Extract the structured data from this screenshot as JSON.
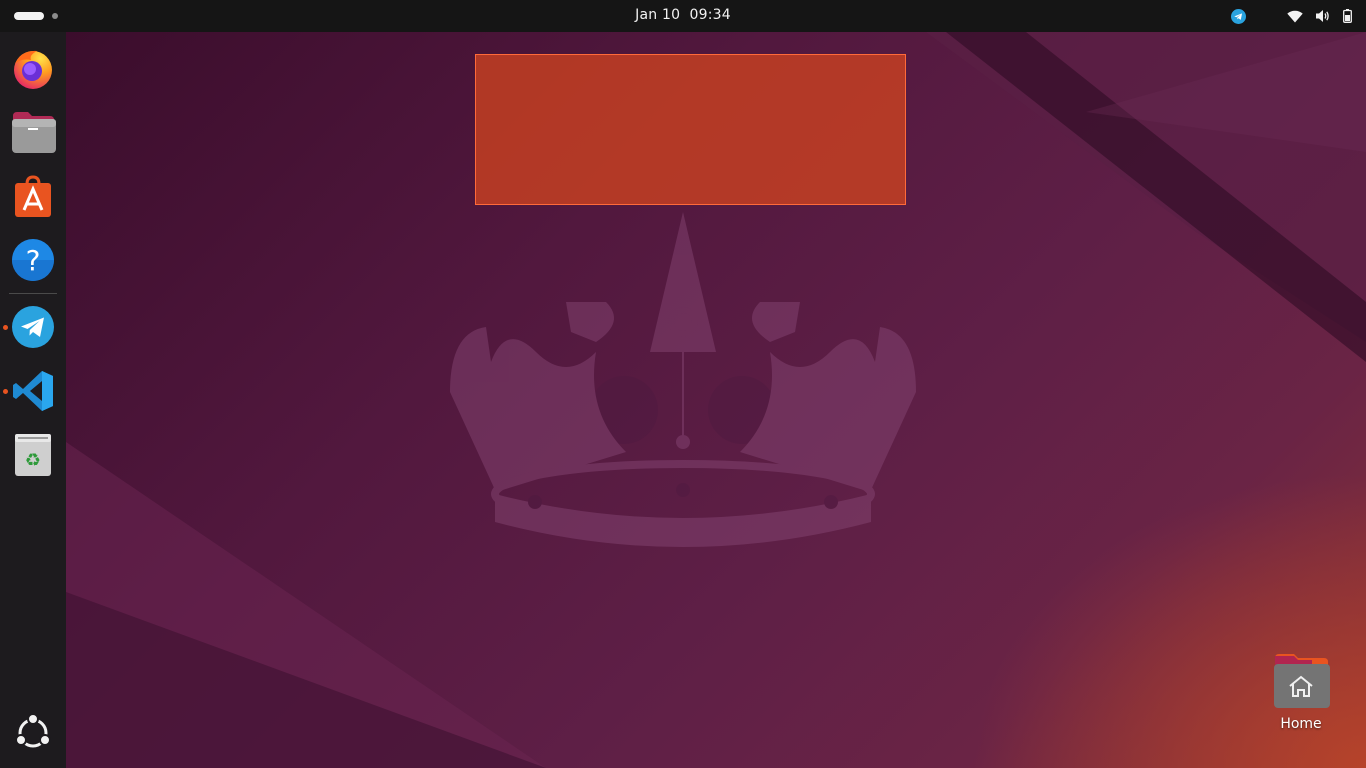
{
  "topbar": {
    "date": "Jan 10",
    "time": "09:34",
    "tray_icons": [
      "telegram-tray-icon",
      "wifi-icon",
      "volume-icon",
      "battery-icon"
    ]
  },
  "dock": {
    "apps": [
      {
        "name": "firefox",
        "icon": "firefox-icon",
        "running": false
      },
      {
        "name": "files",
        "icon": "files-icon",
        "running": false
      },
      {
        "name": "app-center",
        "icon": "app-center-icon",
        "running": false
      },
      {
        "name": "help",
        "icon": "help-icon",
        "running": false
      },
      {
        "name": "telegram",
        "icon": "telegram-icon",
        "running": true
      },
      {
        "name": "vscode",
        "icon": "vscode-icon",
        "running": true
      },
      {
        "name": "trash",
        "icon": "trash-icon",
        "running": false
      }
    ],
    "show_apps_icon": "ubuntu-show-apps-icon"
  },
  "desktop": {
    "home_label": "Home",
    "wallpaper": "ubuntu-noble-numbat-crown"
  },
  "colors": {
    "accent": "#e95420",
    "topbar": "#151515",
    "dock": "#1d1b1e",
    "overlay": "#ce4220"
  }
}
